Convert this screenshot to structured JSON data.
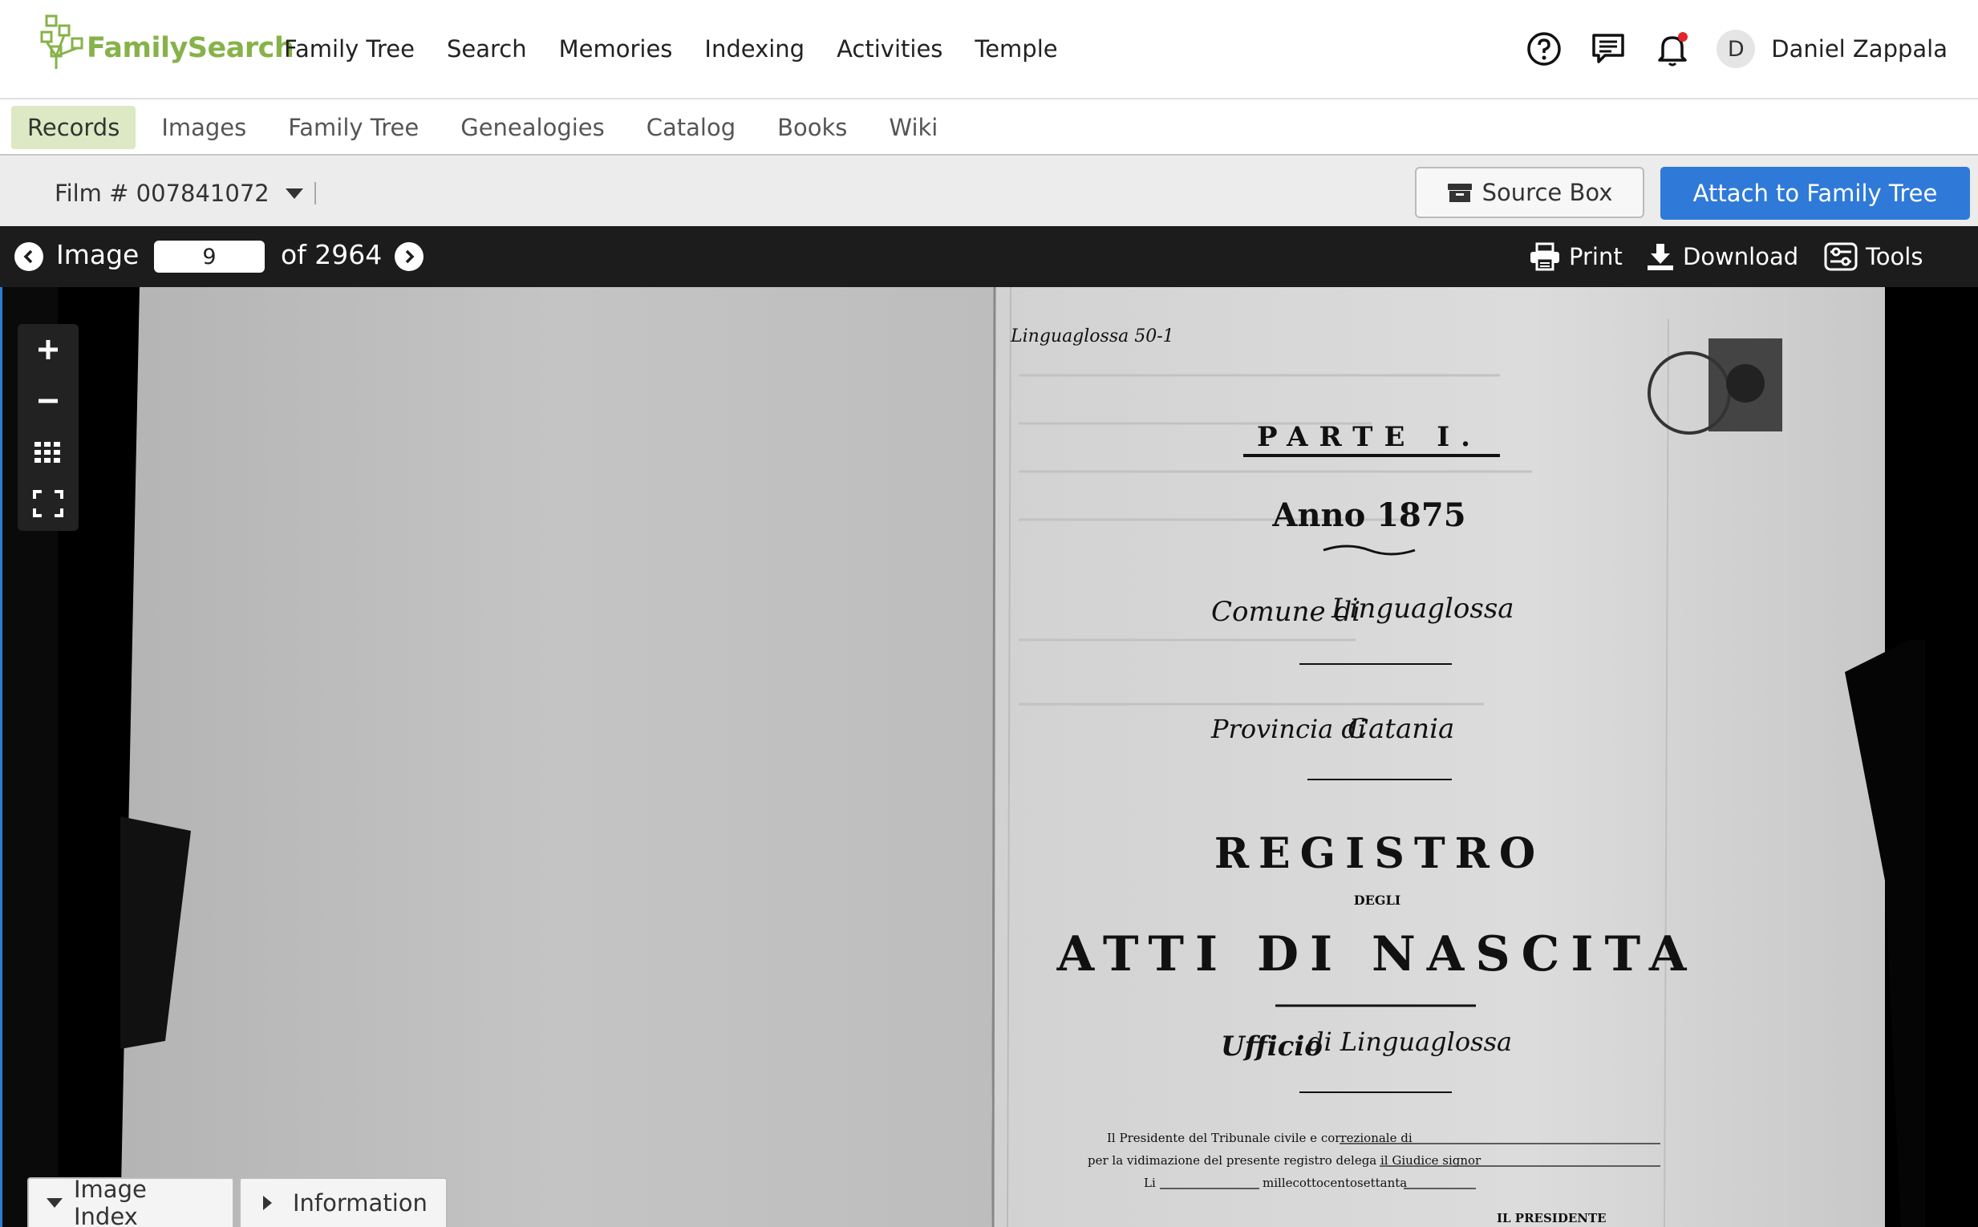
{
  "brand": {
    "name": "FamilySearch",
    "color": "#87b24a"
  },
  "main_nav": [
    "Family Tree",
    "Search",
    "Memories",
    "Indexing",
    "Activities",
    "Temple"
  ],
  "header_icons": [
    "help-icon",
    "messages-icon",
    "notifications-icon"
  ],
  "user": {
    "initial": "D",
    "name": "Daniel Zappala"
  },
  "sub_nav": {
    "tabs": [
      "Records",
      "Images",
      "Family Tree",
      "Genealogies",
      "Catalog",
      "Books",
      "Wiki"
    ],
    "active": "Records"
  },
  "film": {
    "label": "Film # 007841072"
  },
  "actions": {
    "source_box": "Source Box",
    "attach": "Attach to Family Tree",
    "accent": "#2f7ad8"
  },
  "image_nav": {
    "label": "Image",
    "current": "9",
    "of": "of 2964"
  },
  "tools": {
    "print": "Print",
    "download": "Download",
    "tools": "Tools"
  },
  "document": {
    "margin_note": "Linguaglossa 50-1",
    "parte": "PARTE I.",
    "anno": "Anno 1875",
    "comune_label": "Comune di",
    "comune_value": "Linguaglossa",
    "provincia_label": "Provincia di",
    "provincia_value": "Catania",
    "registro": "REGISTRO",
    "degli": "DEGLI",
    "atti": "ATTI DI NASCITA",
    "ufficio_label": "Ufficio",
    "ufficio_value": "di Linguaglossa",
    "line1": "Il Presidente del Tribunale civile e correzionale di",
    "line2": "per la vidimazione del presente registro delega il Giudice signor",
    "line3_prefix": "Li",
    "line3_mid": "millecottocentosettanta",
    "presidente": "IL PRESIDENTE"
  },
  "bottom_tabs": {
    "index": "Image Index",
    "info": "Information"
  }
}
